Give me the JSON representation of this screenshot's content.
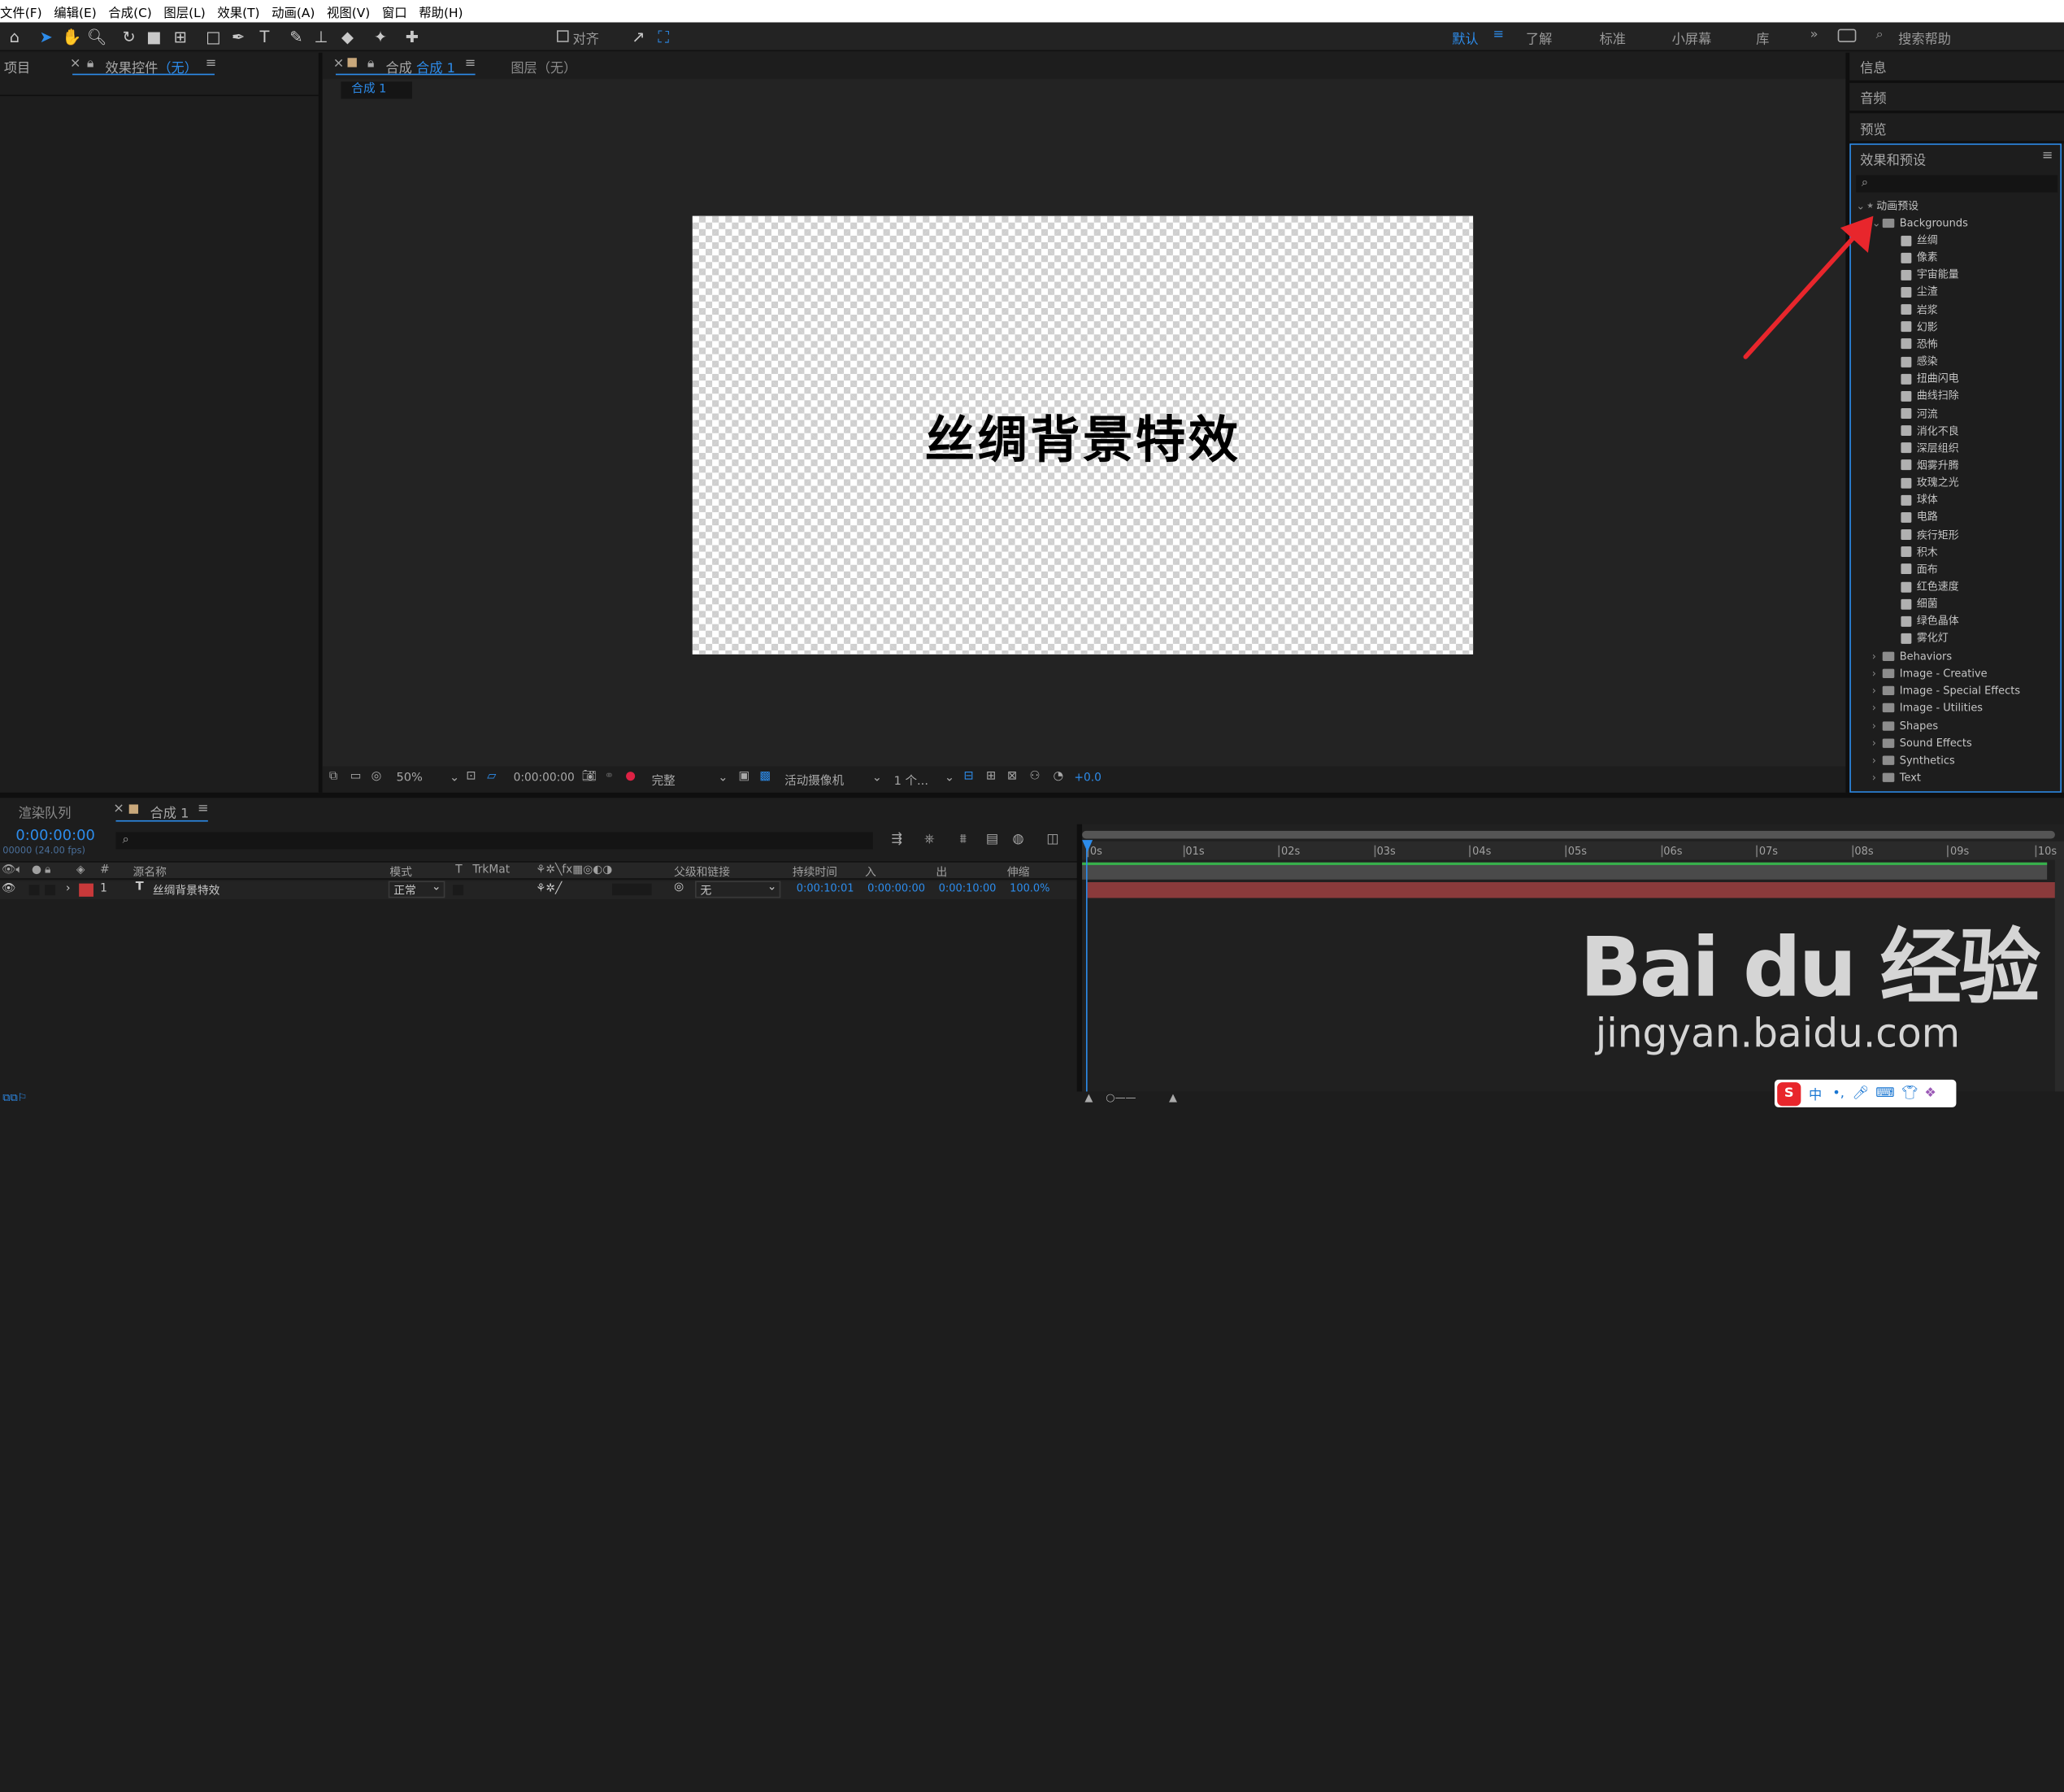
{
  "menu": [
    "文件(F)",
    "编辑(E)",
    "合成(C)",
    "图层(L)",
    "效果(T)",
    "动画(A)",
    "视图(V)",
    "窗口",
    "帮助(H)"
  ],
  "toolbar": {
    "align_label": "对齐",
    "workspaces": [
      "默认",
      "了解",
      "标准",
      "小屏幕",
      "库"
    ],
    "search_placeholder": "搜索帮助"
  },
  "left_panel": {
    "project_tab": "项目",
    "effects_tab_prefix": "效果控件",
    "effects_tab_value": "（无）"
  },
  "comp_panel": {
    "tab_prefix": "合成",
    "tab_name": "合成 1",
    "layer_tab": "图层（无）",
    "breadcrumb": "合成 1",
    "canvas_text": "丝绸背景特效"
  },
  "viewer_footer": {
    "zoom": "50%",
    "timecode": "0:00:00:00",
    "resolution": "完整",
    "camera": "活动摄像机",
    "views": "1 个...",
    "exposure": "+0.0"
  },
  "right_panel": {
    "info": "信息",
    "audio": "音频",
    "preview": "预览",
    "effects_presets_title": "效果和预设"
  },
  "tree": {
    "root": "动画预设",
    "backgrounds": "Backgrounds",
    "presets": [
      "丝绸",
      "像素",
      "宇宙能量",
      "尘渣",
      "岩浆",
      "幻影",
      "恐怖",
      "感染",
      "扭曲闪电",
      "曲线扫除",
      "河流",
      "消化不良",
      "深层组织",
      "烟雾升腾",
      "玫瑰之光",
      "球体",
      "电路",
      "疾行矩形",
      "积木",
      "面布",
      "红色速度",
      "细菌",
      "绿色晶体",
      "雾化灯"
    ],
    "folders": [
      "Behaviors",
      "Image - Creative",
      "Image - Special Effects",
      "Image - Utilities",
      "Shapes",
      "Sound Effects",
      "Synthetics",
      "Text"
    ]
  },
  "timeline": {
    "render_queue_tab": "渲染队列",
    "comp_tab": "合成 1",
    "current_time": "0:00:00:00",
    "frame_info": "00000 (24.00 fps)",
    "search_placeholder": "",
    "headers": {
      "number": "#",
      "source_name": "源名称",
      "mode": "模式",
      "t": "T",
      "trkmat": "TrkMat",
      "parent": "父级和链接",
      "duration": "持续时间",
      "in": "入",
      "out": "出",
      "stretch": "伸缩"
    },
    "layer": {
      "index": "1",
      "type_glyph": "T",
      "name": "丝绸背景特效",
      "mode": "正常",
      "parent": "无",
      "duration": "0:00:10:01",
      "in": "0:00:00:00",
      "out": "0:00:10:00",
      "stretch": "100.0%"
    },
    "ruler": [
      "0s",
      "01s",
      "02s",
      "03s",
      "04s",
      "05s",
      "06s",
      "07s",
      "08s",
      "09s",
      "10s"
    ]
  },
  "watermark": {
    "logo": "Bai du 经验",
    "url": "jingyan.baidu.com"
  },
  "ime": {
    "label": "中"
  },
  "colors": {
    "accent": "#2d8ceb",
    "label_red": "#c8393a",
    "layer_bar": "#8a3a3b",
    "work_area_green": "#37b04b",
    "arrow": "#e8262c"
  }
}
